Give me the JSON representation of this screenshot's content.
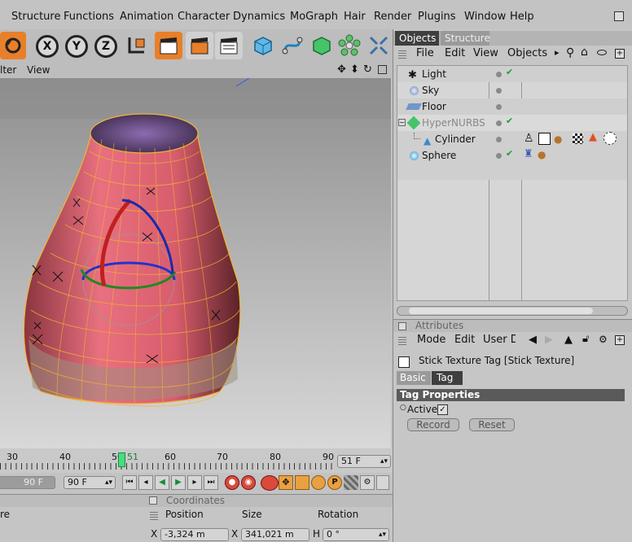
{
  "menu": [
    "Structure",
    "Functions",
    "Animation",
    "Character",
    "Dynamics",
    "MoGraph",
    "Hair",
    "Render",
    "Plugins",
    "Window",
    "Help"
  ],
  "viewport_menu": {
    "filter": "lter",
    "view": "View"
  },
  "axis_buttons": [
    "X",
    "Y",
    "Z"
  ],
  "object_manager": {
    "tabs": [
      "Objects",
      "Structure"
    ],
    "menu": [
      "File",
      "Edit",
      "View",
      "Objects"
    ],
    "objects": [
      {
        "name": "Light",
        "icon": "light-icon",
        "check": true
      },
      {
        "name": "Sky",
        "icon": "sky-icon",
        "check": false
      },
      {
        "name": "Floor",
        "icon": "floor-icon",
        "check": false
      },
      {
        "name": "HyperNURBS",
        "icon": "hypernurbs-icon",
        "check": true,
        "disabled": true
      },
      {
        "name": "Cylinder",
        "icon": "cylinder-icon",
        "check": false
      },
      {
        "name": "Sphere",
        "icon": "sphere-icon",
        "check": true
      }
    ]
  },
  "attributes": {
    "title": "Attributes",
    "menu": [
      "Mode",
      "Edit",
      "User D"
    ],
    "tag_title": "Stick Texture Tag [Stick Texture]",
    "tabs": [
      "Basic",
      "Tag"
    ],
    "section": "Tag Properties",
    "active_label": "Active",
    "record": "Record",
    "reset": "Reset"
  },
  "timeline": {
    "ticks": [
      "30",
      "40",
      "50",
      "60",
      "70",
      "80",
      "90"
    ],
    "current_marker": "51",
    "current_frame": "51 F"
  },
  "transport": {
    "end_frame_left": "90 F",
    "end_frame": "90 F"
  },
  "coordinates": {
    "title": "Coordinates",
    "cols": [
      "Position",
      "Size",
      "Rotation"
    ],
    "row_label_left": "re",
    "x_pos_label": "X",
    "x_pos": "-3,324 m",
    "x_size_label": "X",
    "x_size": "341,021 m",
    "h_label": "H",
    "h_rot": "0 °"
  },
  "colors": {
    "accent": "#e87f2a",
    "selected_tab": "#3f3f3f",
    "section_bar": "#5a5a5a"
  }
}
